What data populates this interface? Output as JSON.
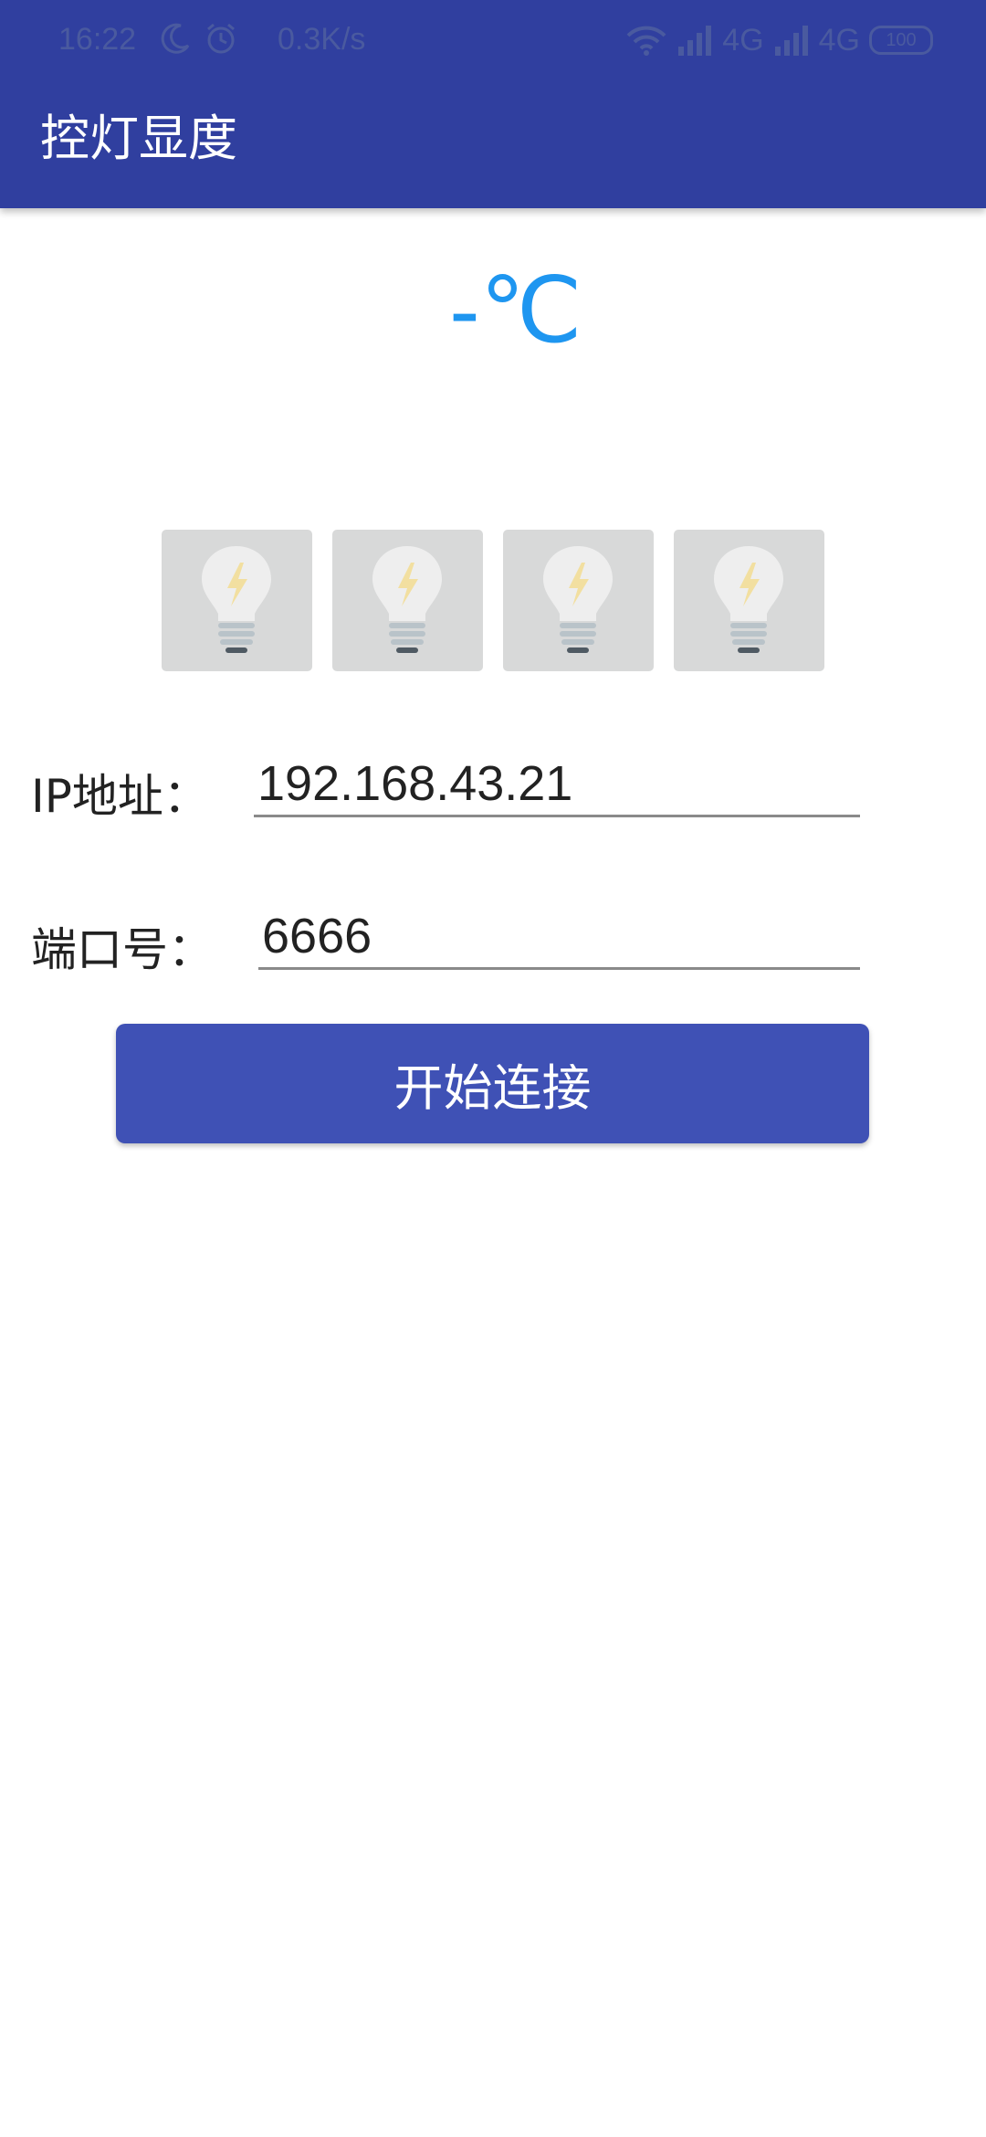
{
  "status_bar": {
    "time": "16:22",
    "net_speed": "0.3K/s",
    "network_left": "4G",
    "network_right": "4G",
    "battery": "100",
    "icons": [
      "moon-icon",
      "alarm-icon",
      "wifi-icon",
      "signal-icon",
      "battery-icon"
    ]
  },
  "app_bar": {
    "title": "控灯显度"
  },
  "temperature": {
    "value": "-℃"
  },
  "lights": {
    "items": [
      {
        "name": "light-1",
        "state": "off"
      },
      {
        "name": "light-2",
        "state": "off"
      },
      {
        "name": "light-3",
        "state": "off"
      },
      {
        "name": "light-4",
        "state": "off"
      }
    ],
    "icon": "lightbulb-icon"
  },
  "form": {
    "ip_label": "IP地址：",
    "ip_value": "192.168.43.21",
    "port_label": "端口号：",
    "port_value": "6666",
    "connect_label": "开始连接"
  },
  "colors": {
    "primary_dark": "#303F9F",
    "primary": "#3F51B5",
    "temperature": "#1E96F0",
    "bulb_tile": "#D8D9D9"
  }
}
